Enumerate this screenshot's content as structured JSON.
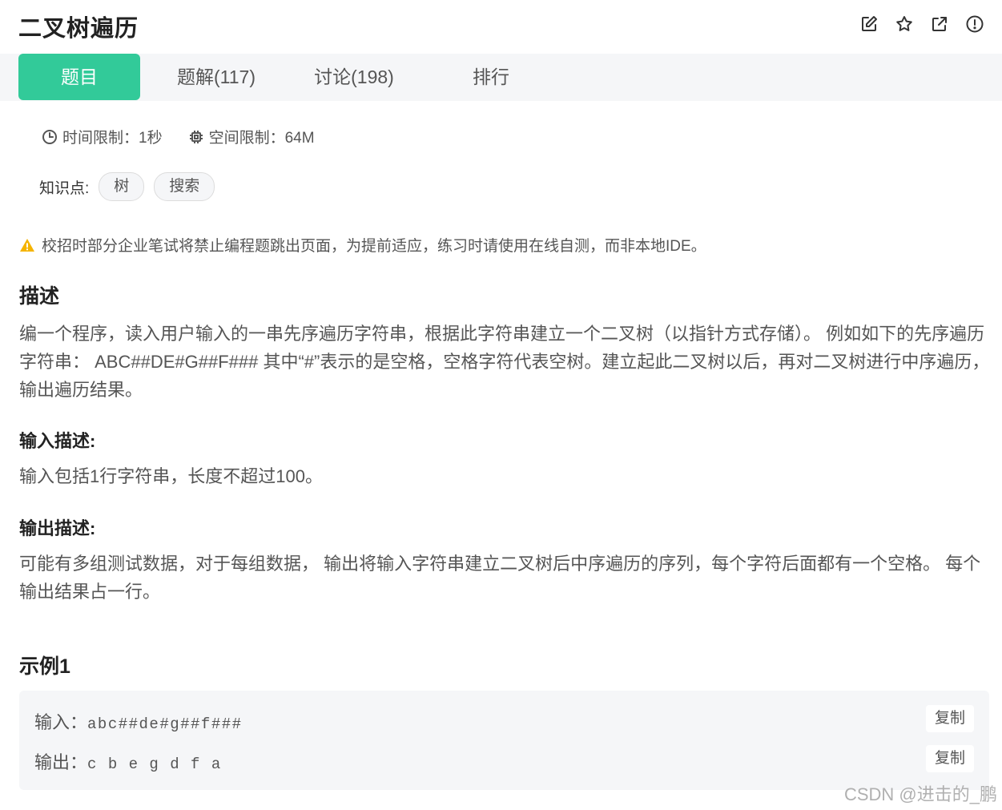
{
  "header": {
    "title": "二叉树遍历",
    "icons": [
      "edit-icon",
      "star-icon",
      "external-link-icon",
      "info-icon"
    ]
  },
  "tabs": [
    {
      "label": "题目",
      "active": true
    },
    {
      "label": "题解(117)",
      "active": false
    },
    {
      "label": "讨论(198)",
      "active": false
    },
    {
      "label": "排行",
      "active": false
    }
  ],
  "meta": {
    "time_limit": "时间限制：1秒",
    "memory_limit": "空间限制：64M"
  },
  "knowledge": {
    "label": "知识点:",
    "tags": [
      "树",
      "搜索"
    ]
  },
  "notice": "校招时部分企业笔试将禁止编程题跳出页面，为提前适应，练习时请使用在线自测，而非本地IDE。",
  "description": {
    "title": "描述",
    "text": "编一个程序，读入用户输入的一串先序遍历字符串，根据此字符串建立一个二叉树（以指针方式存储）。 例如如下的先序遍历字符串： ABC##DE#G##F### 其中“#”表示的是空格，空格字符代表空树。建立起此二叉树以后，再对二叉树进行中序遍历，输出遍历结果。"
  },
  "input_desc": {
    "title": "输入描述:",
    "text": "输入包括1行字符串，长度不超过100。"
  },
  "output_desc": {
    "title": "输出描述:",
    "text": "可能有多组测试数据，对于每组数据， 输出将输入字符串建立二叉树后中序遍历的序列，每个字符后面都有一个空格。 每个输出结果占一行。"
  },
  "example": {
    "title": "示例1",
    "input_label": "输入：",
    "input_value": "abc##de#g##f###",
    "output_label": "输出：",
    "output_value": "c b e g d f a",
    "copy_label": "复制"
  },
  "watermark": "CSDN @进击的_鹏",
  "colors": {
    "accent": "#32ca99",
    "warning": "#f5b400"
  }
}
